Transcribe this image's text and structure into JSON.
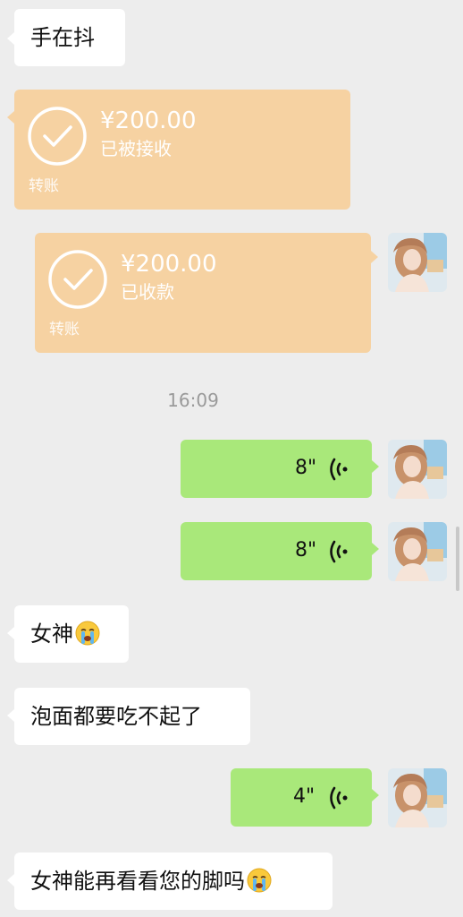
{
  "messages": {
    "m1": {
      "text": "手在抖"
    },
    "transfer_received": {
      "amount": "¥200.00",
      "status": "已被接收",
      "footer": "转账"
    },
    "transfer_sent": {
      "amount": "¥200.00",
      "status": "已收款",
      "footer": "转账"
    },
    "timestamp": "16:09",
    "voice1": {
      "duration": "8\""
    },
    "voice2": {
      "duration": "8\""
    },
    "m_goddess": {
      "text": "女神"
    },
    "m_noodles": {
      "text": "泡面都要吃不起了"
    },
    "voice3": {
      "duration": "4\""
    },
    "m_feet": {
      "text": "女神能再看看您的脚吗"
    }
  },
  "colors": {
    "background": "#ededed",
    "incoming_bubble": "#ffffff",
    "outgoing_bubble": "#a9e87a",
    "transfer_bubble": "#f6d2a2"
  },
  "icons": [
    "check-circle-icon",
    "voice-wave-icon",
    "crying-emoji-icon",
    "avatar"
  ]
}
